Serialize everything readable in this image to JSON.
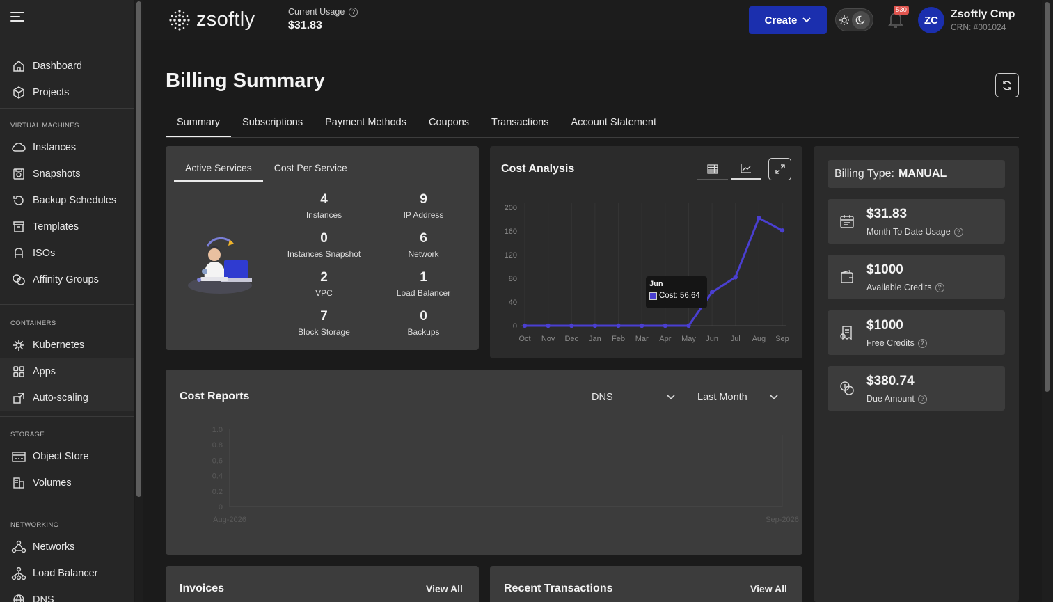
{
  "sidebar": {
    "top_items": [
      {
        "label": "Dashboard",
        "icon": "home-icon"
      },
      {
        "label": "Projects",
        "icon": "cube-icon"
      }
    ],
    "sections": [
      {
        "title": "VIRTUAL MACHINES",
        "items": [
          {
            "label": "Instances",
            "icon": "cloud-icon"
          },
          {
            "label": "Snapshots",
            "icon": "snapshot-icon"
          },
          {
            "label": "Backup Schedules",
            "icon": "history-icon"
          },
          {
            "label": "Templates",
            "icon": "template-icon"
          },
          {
            "label": "ISOs",
            "icon": "iso-icon"
          },
          {
            "label": "Affinity Groups",
            "icon": "affinity-icon"
          }
        ]
      },
      {
        "title": "CONTAINERS",
        "items": [
          {
            "label": "Kubernetes",
            "icon": "kubernetes-icon"
          },
          {
            "label": "Apps",
            "icon": "apps-grid-icon"
          },
          {
            "label": "Auto-scaling",
            "icon": "autoscale-icon"
          }
        ]
      },
      {
        "title": "STORAGE",
        "items": [
          {
            "label": "Object Store",
            "icon": "object-store-icon"
          },
          {
            "label": "Volumes",
            "icon": "volumes-icon"
          }
        ]
      },
      {
        "title": "NETWORKING",
        "items": [
          {
            "label": "Networks",
            "icon": "network-icon"
          },
          {
            "label": "Load Balancer",
            "icon": "load-balancer-icon"
          },
          {
            "label": "DNS",
            "icon": "dns-icon"
          }
        ]
      }
    ]
  },
  "topbar": {
    "logo_text": "zsoftly",
    "usage_label": "Current Usage",
    "usage_value": "$31.83",
    "create_label": "Create",
    "notification_count": "530",
    "avatar_initials": "ZC",
    "user_name": "Zsoftly Cmp",
    "user_crn": "CRN: #001024"
  },
  "page": {
    "title": "Billing Summary",
    "tabs": [
      "Summary",
      "Subscriptions",
      "Payment Methods",
      "Coupons",
      "Transactions",
      "Account Statement"
    ]
  },
  "services": {
    "tabs": [
      "Active Services",
      "Cost Per Service"
    ],
    "items": [
      {
        "value": "4",
        "label": "Instances"
      },
      {
        "value": "9",
        "label": "IP Address"
      },
      {
        "value": "0",
        "label": "Instances Snapshot"
      },
      {
        "value": "6",
        "label": "Network"
      },
      {
        "value": "2",
        "label": "VPC"
      },
      {
        "value": "1",
        "label": "Load Balancer"
      },
      {
        "value": "7",
        "label": "Block Storage"
      },
      {
        "value": "0",
        "label": "Backups"
      }
    ]
  },
  "cost_analysis": {
    "title": "Cost Analysis",
    "tooltip_month": "Jun",
    "tooltip_text": "Cost: 56.64"
  },
  "chart_data": [
    {
      "type": "line",
      "title": "Cost Analysis",
      "categories": [
        "Oct",
        "Nov",
        "Dec",
        "Jan",
        "Feb",
        "Mar",
        "Apr",
        "May",
        "Jun",
        "Jul",
        "Aug",
        "Sep"
      ],
      "series": [
        {
          "name": "Cost",
          "values": [
            0,
            0,
            0,
            0,
            0,
            0,
            0,
            0,
            56.64,
            82,
            182,
            161
          ]
        }
      ],
      "yticks": [
        "0",
        "40",
        "80",
        "120",
        "160",
        "200"
      ],
      "ylim": [
        0,
        200
      ],
      "color": "#4a3fd1"
    },
    {
      "type": "line",
      "title": "Cost Reports",
      "categories": [
        "Aug-2026",
        "Sep-2026"
      ],
      "series": [],
      "yticks": [
        "0",
        "0.2",
        "0.4",
        "0.6",
        "0.8",
        "1.0"
      ],
      "ylim": [
        0,
        1
      ]
    }
  ],
  "billing": {
    "type_label": "Billing Type:",
    "type_value": "MANUAL",
    "stats": [
      {
        "value": "$31.83",
        "label": "Month To Date Usage",
        "icon": "calendar-icon"
      },
      {
        "value": "$1000",
        "label": "Available Credits",
        "icon": "wallet-icon"
      },
      {
        "value": "$1000",
        "label": "Free Credits",
        "icon": "receipt-icon"
      },
      {
        "value": "$380.74",
        "label": "Due Amount",
        "icon": "coins-icon"
      }
    ]
  },
  "cost_reports": {
    "title": "Cost Reports",
    "service_select": "DNS",
    "period_select": "Last Month"
  },
  "invoices": {
    "title": "Invoices",
    "view_all": "View All"
  },
  "recent_transactions": {
    "title": "Recent Transactions",
    "view_all": "View All"
  }
}
